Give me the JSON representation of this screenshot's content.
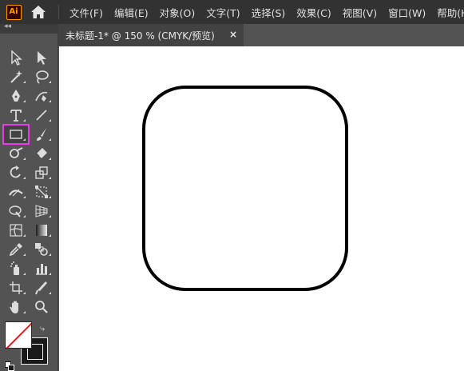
{
  "app": {
    "logo_text": "Ai",
    "logo_color": "#ff9a00",
    "menu": [
      "文件(F)",
      "编辑(E)",
      "对象(O)",
      "文字(T)",
      "选择(S)",
      "效果(C)",
      "视图(V)",
      "窗口(W)",
      "帮助(H)"
    ]
  },
  "toolbar": {
    "collapse_glyph": "◂◂",
    "tools": [
      [
        "selection-tool-icon",
        "direct-selection-tool-icon"
      ],
      [
        "magic-wand-tool-icon",
        "lasso-tool-icon"
      ],
      [
        "pen-tool-icon",
        "curvature-tool-icon"
      ],
      [
        "type-tool-icon",
        "line-segment-tool-icon"
      ],
      [
        "rectangle-tool-icon",
        "paintbrush-tool-icon"
      ],
      [
        "shaper-tool-icon",
        "eraser-tool-icon"
      ],
      [
        "rotate-tool-icon",
        "scale-tool-icon"
      ],
      [
        "width-tool-icon",
        "free-transform-tool-icon"
      ],
      [
        "shape-builder-tool-icon",
        "perspective-grid-tool-icon"
      ],
      [
        "mesh-tool-icon",
        "gradient-tool-icon"
      ],
      [
        "eyedropper-tool-icon",
        "blend-tool-icon"
      ],
      [
        "symbol-sprayer-tool-icon",
        "column-graph-tool-icon"
      ],
      [
        "artboard-tool-icon",
        "slice-tool-icon"
      ],
      [
        "hand-tool-icon",
        "zoom-tool-icon"
      ]
    ],
    "selected_tool": "rectangle-tool-icon",
    "selected_outline_color": "#e53ce5",
    "fill_color": "#ffffff",
    "fill_none_slash_color": "#e02020",
    "stroke_color": "#000000"
  },
  "document": {
    "tab_title": "未标题-1* @ 150 % (CMYK/预览)",
    "close_glyph": "×"
  },
  "canvas": {
    "background": "#ffffff",
    "shape": "rounded-rectangle",
    "stroke_color": "#000000",
    "fill": "none"
  }
}
